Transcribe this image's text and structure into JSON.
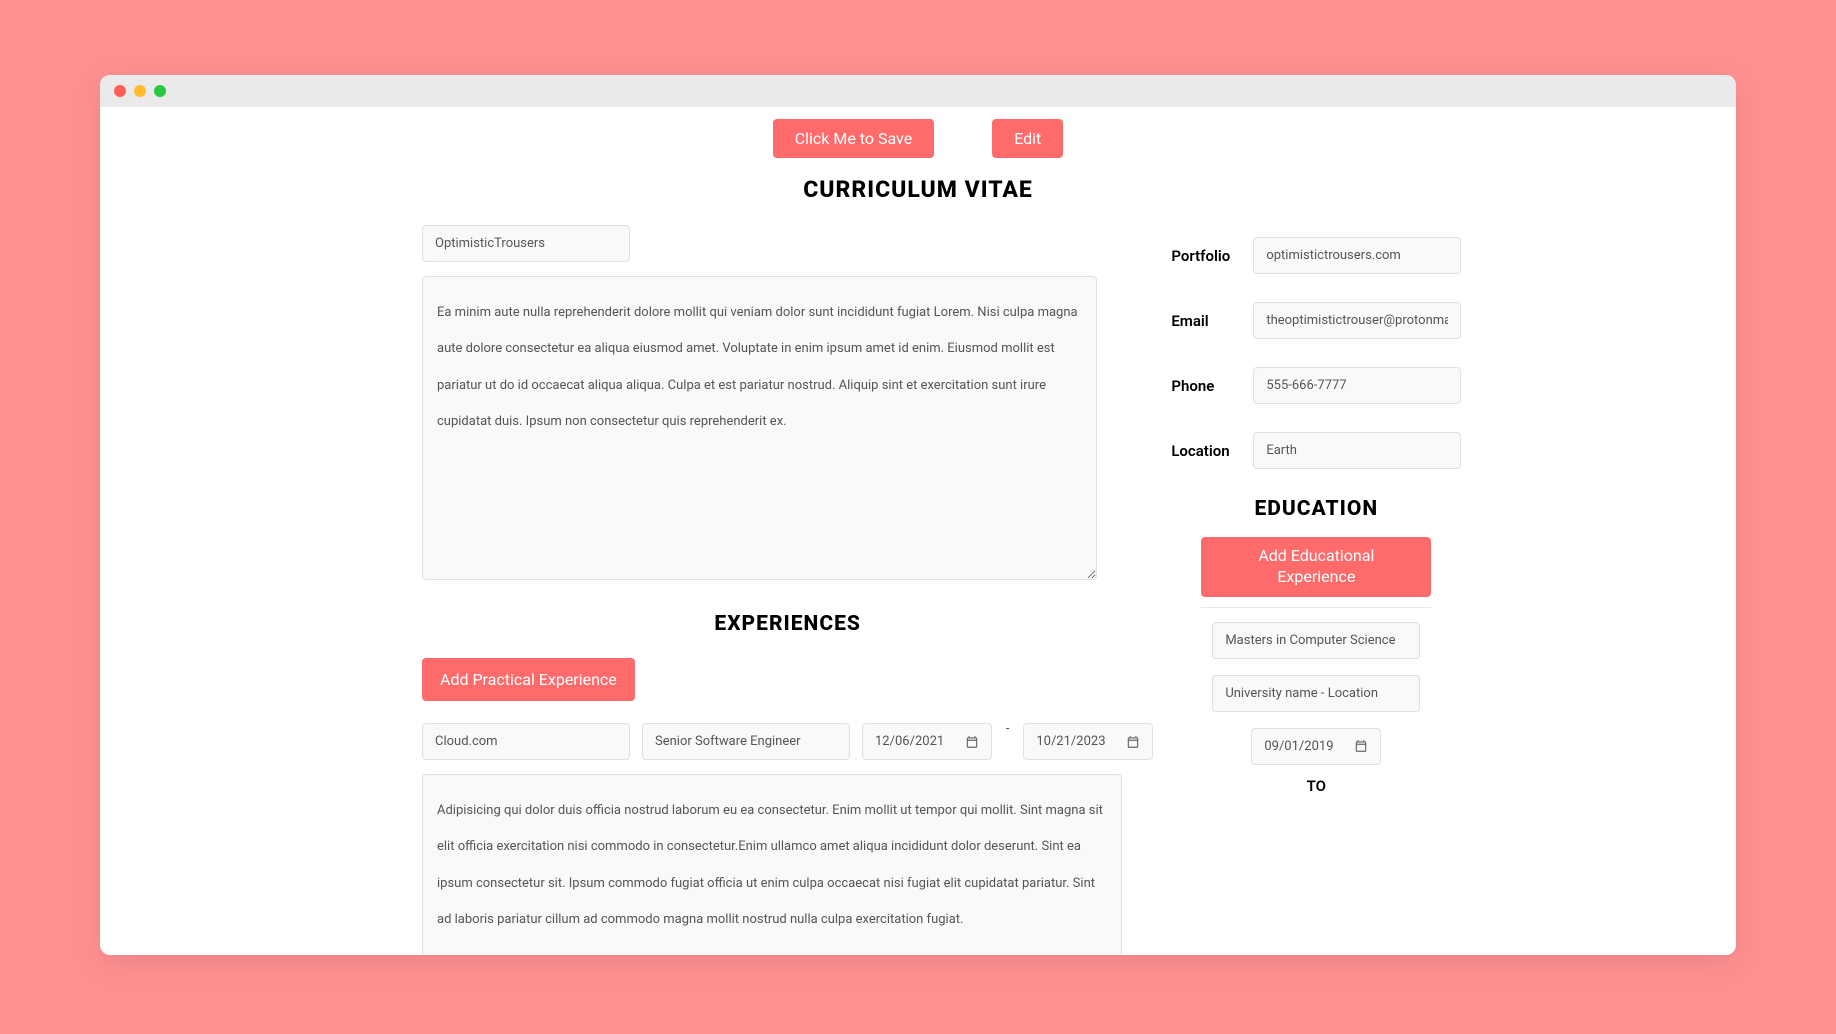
{
  "buttons": {
    "save": "Click Me to Save",
    "edit": "Edit",
    "add_exp": "Add Practical Experience",
    "add_edu": "Add Educational Experience"
  },
  "titles": {
    "main": "CURRICULUM VITAE",
    "experiences": "EXPERIENCES",
    "education": "EDUCATION"
  },
  "profile": {
    "name": "OptimisticTrousers",
    "bio": "Ea minim aute nulla reprehenderit dolore mollit qui veniam dolor sunt incididunt fugiat Lorem. Nisi culpa magna aute dolore consectetur ea aliqua eiusmod amet. Voluptate in enim ipsum amet id enim. Eiusmod mollit est pariatur ut do id occaecat aliqua aliqua. Culpa et est pariatur nostrud. Aliquip sint et exercitation sunt irure cupidatat duis. Ipsum non consectetur quis reprehenderit ex."
  },
  "contact": {
    "portfolio_label": "Portfolio",
    "portfolio": "optimistictrousers.com",
    "email_label": "Email",
    "email": "theoptimistictrouser@protonmail",
    "phone_label": "Phone",
    "phone": "555-666-7777",
    "location_label": "Location",
    "location": "Earth"
  },
  "experience": {
    "company": "Cloud.com",
    "title": "Senior Software Engineer",
    "date_from": "12/06/2021",
    "date_to": "10/21/2023",
    "date_sep": "-",
    "description": "Adipisicing qui dolor duis officia nostrud laborum eu ea consectetur. Enim mollit ut tempor qui mollit. Sint magna sit elit officia exercitation nisi commodo in consectetur.Enim ullamco amet aliqua incididunt dolor deserunt. Sint ea ipsum consectetur sit. Ipsum commodo fugiat officia ut enim culpa occaecat nisi fugiat elit cupidatat pariatur. Sint ad laboris pariatur cillum ad commodo magna mollit nostrud nulla culpa exercitation fugiat."
  },
  "education": {
    "degree": "Masters in Computer Science",
    "school": "University name - Location",
    "date_from": "09/01/2019",
    "to_label": "TO"
  }
}
